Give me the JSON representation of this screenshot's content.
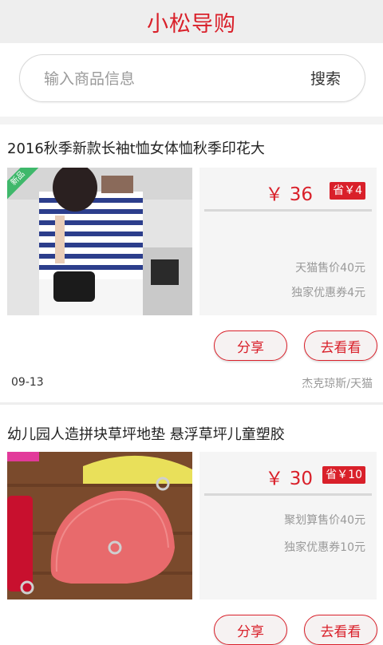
{
  "header": {
    "title": "小松导购"
  },
  "search": {
    "placeholder": "输入商品信息",
    "button_label": "搜索"
  },
  "items": [
    {
      "title": "2016秋季新款长袖t恤女体恤秋季印花大",
      "image_tag": "新品",
      "price": "￥ 36",
      "save": "省￥4",
      "line1": "天猫售价40元",
      "line2": "独家优惠券4元",
      "share_label": "分享",
      "view_label": "去看看",
      "date": "09-13",
      "shop": "杰克琼斯/天猫"
    },
    {
      "title": "幼儿园人造拼块草坪地垫 悬浮草坪儿童塑胶",
      "price": "￥ 30",
      "save": "省￥10",
      "line1": "聚划算售价40元",
      "line2": "独家优惠券10元",
      "share_label": "分享",
      "view_label": "去看看"
    }
  ],
  "colors": {
    "accent": "#d9202a",
    "header_bg": "#eeeeee",
    "panel_bg": "#f5f5f5"
  }
}
